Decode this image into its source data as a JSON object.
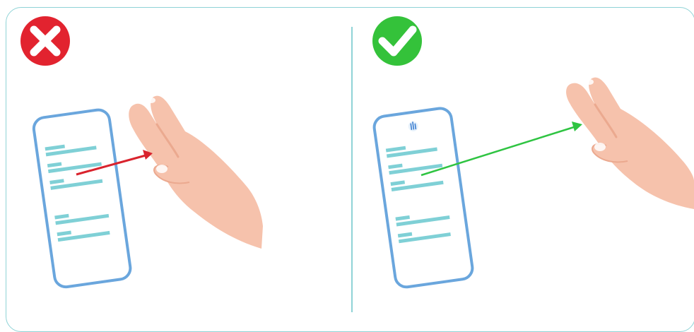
{
  "panels": [
    {
      "id": "incorrect",
      "status": "wrong",
      "badge_icon": "cross-icon",
      "badge_color": "#e2232f",
      "arrow_color": "#d9232d",
      "phone_icon_shown": false
    },
    {
      "id": "correct",
      "status": "right",
      "badge_icon": "check-icon",
      "badge_color": "#34c23a",
      "arrow_color": "#2fc442",
      "phone_icon_shown": true,
      "phone_icon": "hand-gesture-icon"
    }
  ],
  "colors": {
    "frame": "#8fd3d6",
    "phone_outline": "#6aa6dd",
    "text_lines": "#7fd0d6",
    "skin": "#f6c2ac",
    "skin_shadow": "#eba98f"
  }
}
